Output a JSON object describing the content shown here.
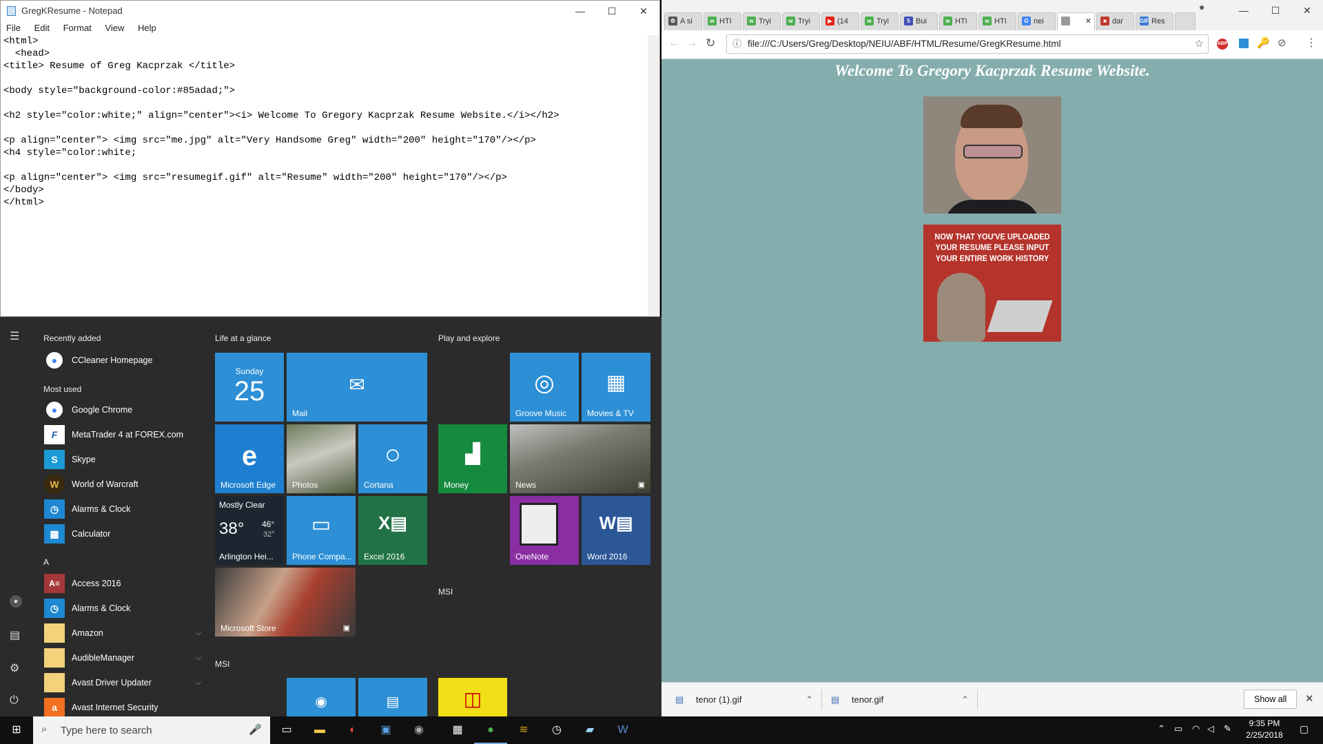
{
  "notepad": {
    "title": "GregKResume - Notepad",
    "menu": [
      "File",
      "Edit",
      "Format",
      "View",
      "Help"
    ],
    "lines": [
      "<html>",
      "  <head>",
      "<title> Resume of Greg Kacprzak </title>",
      "",
      "<body style=\"background-color:#85adad;\">",
      "",
      "<h2 style=\"color:white;\" align=\"center\"><i> Welcome To Gregory Kacprzak Resume Website.</i></h2>",
      "",
      "<p align=\"center\"> <img src=\"me.jpg\" alt=\"Very Handsome Greg\" width=\"200\" height=\"170\"/></p>",
      "<h4 style=\"color:white;",
      "",
      "<p align=\"center\"> <img src=\"resumegif.gif\" alt=\"Resume\" width=\"200\" height=\"170\"/></p>",
      "</body>",
      "</html>"
    ]
  },
  "start_menu": {
    "recently_added_header": "Recently added",
    "recently_added": [
      {
        "label": "CCleaner Homepage",
        "icon": "chrome-icon",
        "color": "#ffffff"
      }
    ],
    "most_used_header": "Most used",
    "most_used": [
      {
        "label": "Google Chrome",
        "icon": "chrome-icon",
        "color": "#ffffff"
      },
      {
        "label": "MetaTrader 4 at FOREX.com",
        "icon": "metatrader-icon",
        "color": "#1f5fa8"
      },
      {
        "label": "Skype",
        "icon": "skype-icon",
        "color": "#1c9ad6"
      },
      {
        "label": "World of Warcraft",
        "icon": "wow-icon",
        "color": "#3a2a10"
      },
      {
        "label": "Alarms & Clock",
        "icon": "clock-icon",
        "color": "#1e88d2"
      },
      {
        "label": "Calculator",
        "icon": "calculator-icon",
        "color": "#1e88d2"
      }
    ],
    "letter_a": "A",
    "a_apps": [
      {
        "label": "Access 2016",
        "icon": "access-icon",
        "color": "#a4373a",
        "glyph": "A≡",
        "expand": false
      },
      {
        "label": "Alarms & Clock",
        "icon": "clock-icon",
        "color": "#1e88d2",
        "glyph": "◷",
        "expand": false
      },
      {
        "label": "Amazon",
        "icon": "folder-icon",
        "color": "#f2d27a",
        "glyph": "",
        "expand": true
      },
      {
        "label": "AudibleManager",
        "icon": "folder-icon",
        "color": "#f2d27a",
        "glyph": "",
        "expand": true
      },
      {
        "label": "Avast Driver Updater",
        "icon": "folder-icon",
        "color": "#f2d27a",
        "glyph": "",
        "expand": true
      },
      {
        "label": "Avast Internet Security",
        "icon": "avast-icon",
        "color": "#f36f21",
        "glyph": "a",
        "expand": false
      }
    ],
    "life_header": "Life at a glance",
    "play_header": "Play and explore",
    "msi_header_1": "MSI",
    "msi_header_2": "MSI",
    "calendar": {
      "day": "Sunday",
      "date": "25"
    },
    "weather": {
      "condition": "Mostly Clear",
      "temp": "38°",
      "high": "46°",
      "low": "32°",
      "location": "Arlington Hei..."
    },
    "tiles": {
      "mail": "Mail",
      "edge": "Microsoft Edge",
      "photos": "Photos",
      "cortana": "Cortana",
      "phone": "Phone Compa...",
      "excel": "Excel 2016",
      "store": "Microsoft Store",
      "groove": "Groove Music",
      "movies": "Movies & TV",
      "money": "Money",
      "news": "News",
      "onenote": "OneNote",
      "word": "Word 2016"
    }
  },
  "browser": {
    "tabs": [
      {
        "label": "A si",
        "color": "#555555",
        "mark": "⚙"
      },
      {
        "label": "HTI",
        "color": "#4caf50",
        "mark": "w"
      },
      {
        "label": "Tryi",
        "color": "#4caf50",
        "mark": "w"
      },
      {
        "label": "Tryi",
        "color": "#4caf50",
        "mark": "w"
      },
      {
        "label": "(14",
        "color": "#e62117",
        "mark": "▶"
      },
      {
        "label": "Tryi",
        "color": "#4caf50",
        "mark": "w"
      },
      {
        "label": "Bui",
        "color": "#3f51b5",
        "mark": "5"
      },
      {
        "label": "HTI",
        "color": "#4caf50",
        "mark": "w"
      },
      {
        "label": "HTI",
        "color": "#4caf50",
        "mark": "w"
      },
      {
        "label": "nei",
        "color": "#4285f4",
        "mark": "G"
      },
      {
        "label": "",
        "color": "#999999",
        "mark": ""
      },
      {
        "label": "dar",
        "color": "#c0392b",
        "mark": "■"
      },
      {
        "label": "Res",
        "color": "#3a7bd5",
        "mark": "GIF"
      }
    ],
    "url": "file:///C:/Users/Greg/Desktop/NEIU/ABF/HTML/Resume/GregKResume.html",
    "page_heading": "Welcome To Gregory Kacprzak Resume Website.",
    "gif_caption": "NOW THAT YOU'VE UPLOADED YOUR RESUME PLEASE INPUT YOUR ENTIRE WORK HISTORY",
    "downloads": [
      {
        "name": "tenor (1).gif"
      },
      {
        "name": "tenor.gif"
      }
    ],
    "show_all": "Show all"
  },
  "taskbar": {
    "search_placeholder": "Type here to search",
    "time": "9:35 PM",
    "date": "2/25/2018"
  }
}
